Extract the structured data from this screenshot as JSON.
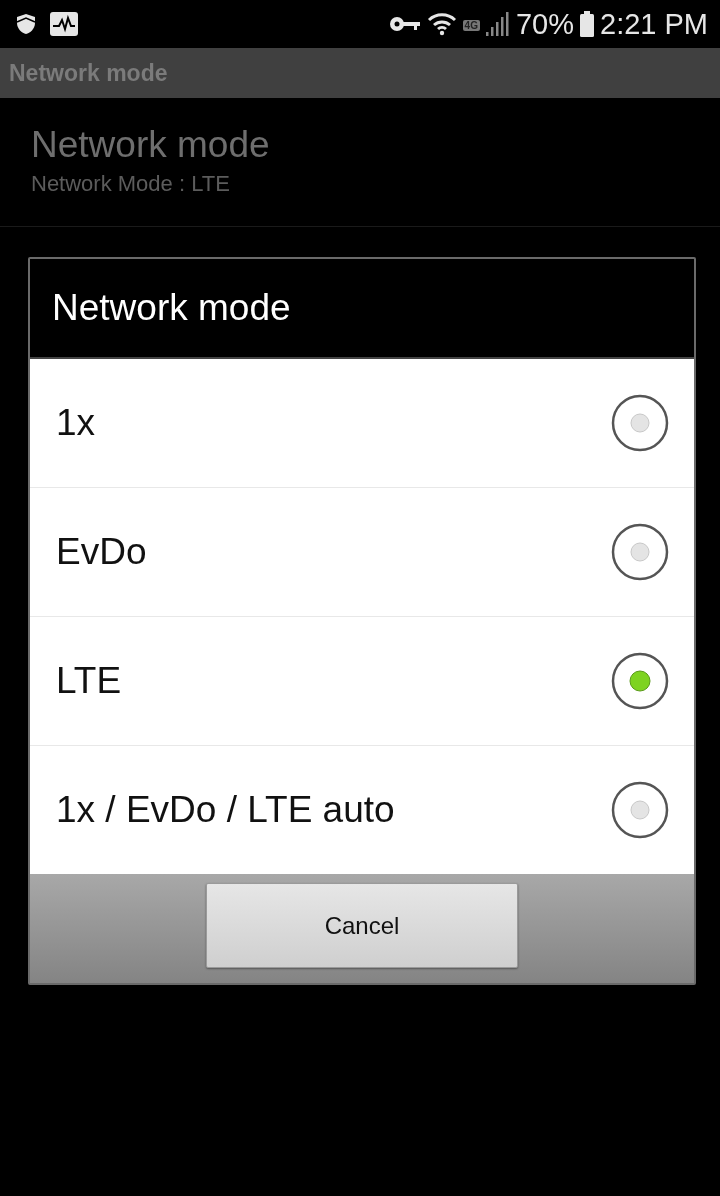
{
  "status_bar": {
    "network_badge": "4G",
    "battery": "70%",
    "time": "2:21 PM"
  },
  "app_bar": {
    "title": "Network mode"
  },
  "preference": {
    "title": "Network mode",
    "summary": "Network Mode : LTE"
  },
  "dialog": {
    "title": "Network mode",
    "options": [
      {
        "label": "1x",
        "selected": false
      },
      {
        "label": "EvDo",
        "selected": false
      },
      {
        "label": "LTE",
        "selected": true
      },
      {
        "label": "1x / EvDo / LTE auto",
        "selected": false
      }
    ],
    "buttons": [
      "Cancel"
    ]
  }
}
